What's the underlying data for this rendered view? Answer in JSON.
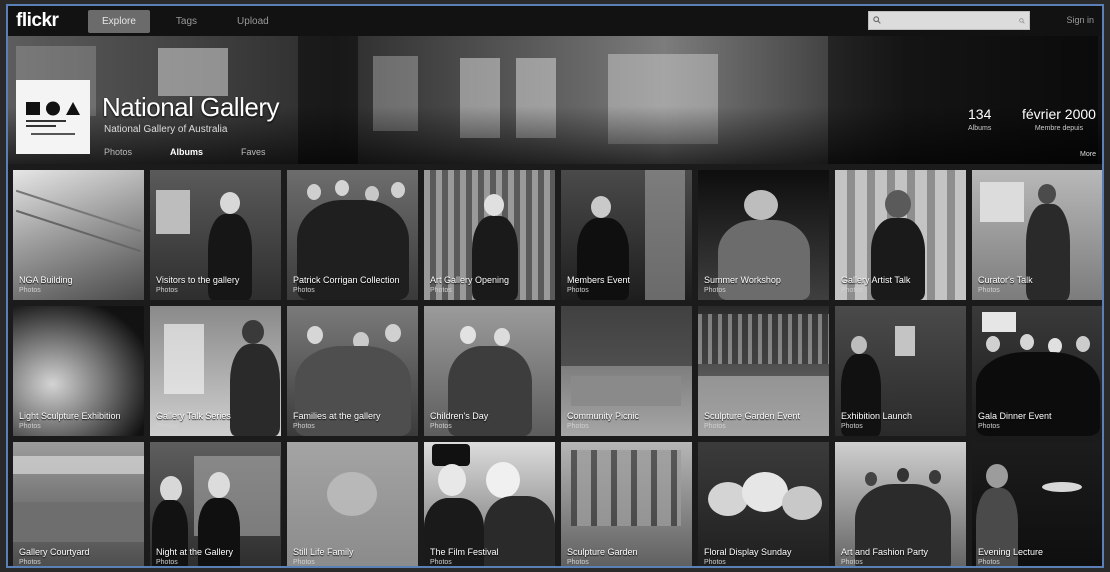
{
  "app": {
    "logo": "flickr"
  },
  "nav": [
    {
      "label": "Explore",
      "active": true
    },
    {
      "label": "Tags",
      "active": false
    },
    {
      "label": "Upload",
      "active": false
    }
  ],
  "search": {
    "placeholder": "",
    "icon": "search-icon"
  },
  "account_link": "Sign in",
  "hero": {
    "title": "National Gallery",
    "subtitle": "National Gallery of Australia",
    "tabs": [
      {
        "label": "Photos",
        "selected": false
      },
      {
        "label": "Albums",
        "selected": true
      },
      {
        "label": "Faves",
        "selected": false
      }
    ],
    "stats": [
      {
        "value": "134",
        "label": "Albums"
      },
      {
        "value": "février 2000",
        "label": "Membre depuis"
      }
    ],
    "more": "More"
  },
  "albums": [
    {
      "title": "NGA Building",
      "subtitle": "Photos"
    },
    {
      "title": "Visitors to the gallery",
      "subtitle": "Photos"
    },
    {
      "title": "Patrick Corrigan Collection",
      "subtitle": "Photos"
    },
    {
      "title": "Art Gallery Opening",
      "subtitle": "Photos"
    },
    {
      "title": "Members Event",
      "subtitle": "Photos"
    },
    {
      "title": "Summer Workshop",
      "subtitle": "Photos"
    },
    {
      "title": "Gallery Artist Talk",
      "subtitle": "Photos"
    },
    {
      "title": "Curator's Talk",
      "subtitle": "Photos"
    },
    {
      "title": "Light Sculpture Exhibition",
      "subtitle": "Photos"
    },
    {
      "title": "Gallery Talk Series",
      "subtitle": "Photos"
    },
    {
      "title": "Families at the gallery",
      "subtitle": "Photos"
    },
    {
      "title": "Children's Day",
      "subtitle": "Photos"
    },
    {
      "title": "Community Picnic",
      "subtitle": "Photos"
    },
    {
      "title": "Sculpture Garden Event",
      "subtitle": "Photos"
    },
    {
      "title": "Exhibition Launch",
      "subtitle": "Photos"
    },
    {
      "title": "Gala Dinner Event",
      "subtitle": "Photos"
    },
    {
      "title": "Gallery Courtyard",
      "subtitle": "Photos"
    },
    {
      "title": "Night at the Gallery",
      "subtitle": "Photos"
    },
    {
      "title": "Still Life Family",
      "subtitle": "Photos"
    },
    {
      "title": "The Film Festival",
      "subtitle": "Photos"
    },
    {
      "title": "Sculpture Garden",
      "subtitle": "Photos"
    },
    {
      "title": "Floral Display Sunday",
      "subtitle": "Photos"
    },
    {
      "title": "Art and Fashion Party",
      "subtitle": "Photos"
    },
    {
      "title": "Evening Lecture",
      "subtitle": "Photos"
    }
  ]
}
